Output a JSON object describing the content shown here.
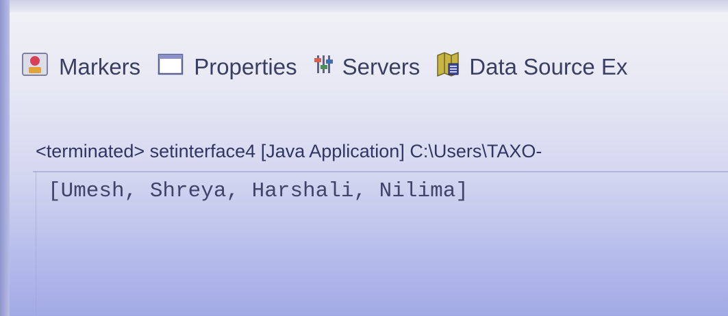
{
  "view_tabs": [
    {
      "label": "Markers",
      "icon": "markers-icon"
    },
    {
      "label": "Properties",
      "icon": "properties-icon"
    },
    {
      "label": "Servers",
      "icon": "servers-icon"
    },
    {
      "label": "Data Source Ex",
      "icon": "data-source-explorer-icon"
    }
  ],
  "console": {
    "header": "<terminated> setinterface4 [Java Application] C:\\Users\\TAXO-",
    "output": "[Umesh, Shreya, Harshali, Nilima]"
  },
  "colors": {
    "text": "#3a3e63",
    "background_top": "#f1f1f6",
    "background_bottom": "#a2aae6"
  }
}
